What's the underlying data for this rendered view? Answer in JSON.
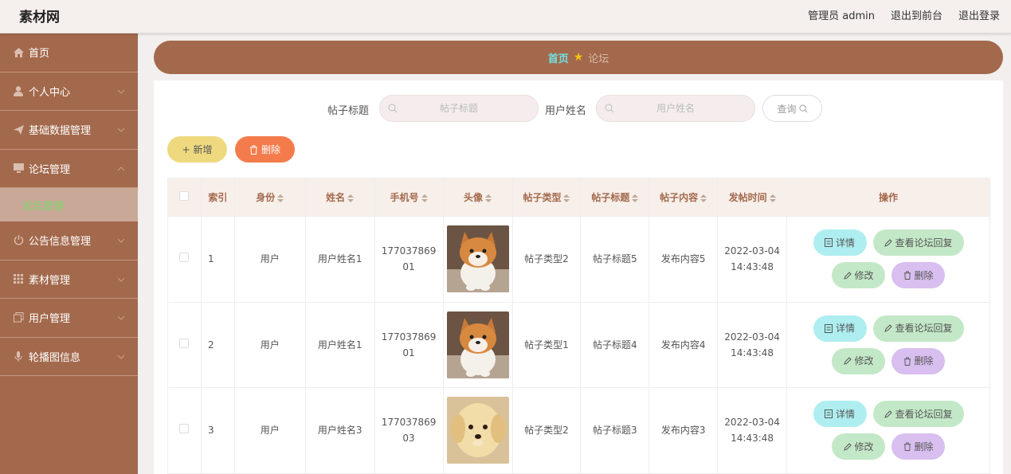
{
  "header": {
    "brand": "素材网",
    "admin_label": "管理员 admin",
    "front_link": "退出到前台",
    "logout_link": "退出登录"
  },
  "sidebar": {
    "items": [
      {
        "label": "首页",
        "icon": "home-icon"
      },
      {
        "label": "个人中心",
        "icon": "user-icon"
      },
      {
        "label": "基础数据管理",
        "icon": "send-icon"
      },
      {
        "label": "论坛管理",
        "icon": "monitor-icon"
      },
      {
        "label": "公告信息管理",
        "icon": "power-icon"
      },
      {
        "label": "素材管理",
        "icon": "grid-icon"
      },
      {
        "label": "用户管理",
        "icon": "copy-icon"
      },
      {
        "label": "轮播图信息",
        "icon": "mic-icon"
      }
    ],
    "active_sub": "论坛管理"
  },
  "breadcrumb": {
    "home": "首页",
    "current": "论坛"
  },
  "search": {
    "title_label": "帖子标题",
    "title_placeholder": "帖子标题",
    "user_label": "用户姓名",
    "user_placeholder": "用户姓名",
    "query_label": "查询"
  },
  "actions": {
    "add_label": "新增",
    "delete_label": "删除"
  },
  "table": {
    "headers": [
      "索引",
      "身份",
      "姓名",
      "手机号",
      "头像",
      "帖子类型",
      "帖子标题",
      "帖子内容",
      "发帖时间",
      "操作"
    ],
    "rows": [
      {
        "index": "1",
        "role": "用户",
        "name": "用户姓名1",
        "phone_a": "177037869",
        "phone_b": "01",
        "type": "帖子类型2",
        "title": "帖子标题5",
        "content": "发布内容5",
        "date": "2022-03-04",
        "time": "14:43:48",
        "avatar": "shiba-dog"
      },
      {
        "index": "2",
        "role": "用户",
        "name": "用户姓名1",
        "phone_a": "177037869",
        "phone_b": "01",
        "type": "帖子类型1",
        "title": "帖子标题4",
        "content": "发布内容4",
        "date": "2022-03-04",
        "time": "14:43:48",
        "avatar": "shiba-dog"
      },
      {
        "index": "3",
        "role": "用户",
        "name": "用户姓名3",
        "phone_a": "177037869",
        "phone_b": "03",
        "type": "帖子类型2",
        "title": "帖子标题3",
        "content": "发布内容3",
        "date": "2022-03-04",
        "time": "14:43:48",
        "avatar": "puppy"
      }
    ],
    "row_actions": {
      "detail": "详情",
      "reply": "查看论坛回复",
      "edit": "修改",
      "remove": "删除"
    }
  },
  "colors": {
    "sidebar_bg": "#a3694c",
    "breadcrumb_home": "#6fe1e5",
    "active_sub": "#7dd86b",
    "add_btn": "#efd97f",
    "delete_btn": "#f47c4c"
  }
}
